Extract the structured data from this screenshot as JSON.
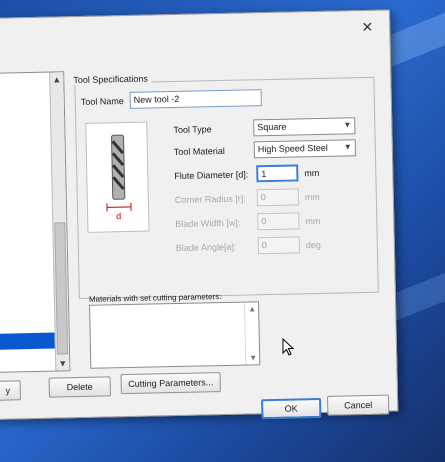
{
  "dialog": {
    "close_glyph": "✕",
    "group_title": "Tool Specifications",
    "tool_name": {
      "label": "Tool Name",
      "value": "New tool -2"
    },
    "tool_type": {
      "label": "Tool Type",
      "value": "Square"
    },
    "tool_material": {
      "label": "Tool Material",
      "value": "High Speed Steel"
    },
    "flute_diameter": {
      "label": "Flute Diameter [d]:",
      "value": "1",
      "unit": "mm"
    },
    "corner_radius": {
      "label": "Corner Radius [r]:",
      "value": "0",
      "unit": "mm"
    },
    "blade_width": {
      "label": "Blade Width [w]:",
      "value": "0",
      "unit": "mm"
    },
    "blade_angle": {
      "label": "Blade Angle[a]:",
      "value": "0",
      "unit": "deg"
    },
    "tool_image_dim_label": "d",
    "materials_label": "Materials with set cutting parameters:",
    "buttons": {
      "left_partial": "y",
      "delete": "Delete",
      "cutting_parameters": "Cutting Parameters...",
      "ok": "OK",
      "cancel": "Cancel"
    }
  },
  "icons": {
    "scroll_up": "▲",
    "scroll_down": "▼",
    "combo_arrow": "▼"
  },
  "colors": {
    "desktop_blue": "#1e4fa8",
    "selection_blue": "#0a58d0",
    "dialog_bg": "#f0f0f0"
  }
}
